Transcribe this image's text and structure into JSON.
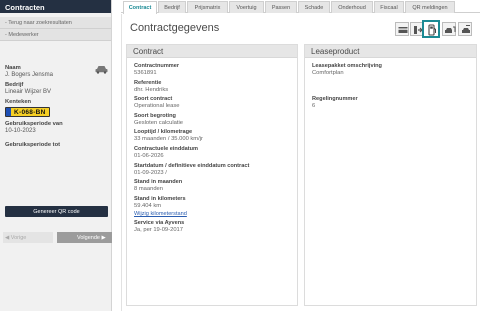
{
  "sidebar": {
    "title": "Contracten",
    "links": [
      "- Terug naar zoekresultaten",
      "- Medewerker"
    ],
    "name_label": "Naam",
    "name_value": "J. Bogers Jensma",
    "company_label": "Bedrijf",
    "company_value": "Lineair Wijzer BV",
    "plate_label": "Kenteken",
    "plate_value": "K-068-BN",
    "period_from_label": "Gebruiksperiode van",
    "period_from_value": "10-10-2023",
    "period_to_label": "Gebruiksperiode tot",
    "period_to_value": "",
    "qr_button": "Genereer QR code",
    "prev_button": "◀ Vorige",
    "next_button": "Volgende ▶"
  },
  "tabs": [
    {
      "label": "Contract",
      "active": true
    },
    {
      "label": "Bedrijf",
      "active": false
    },
    {
      "label": "Prijsmatrix",
      "active": false
    },
    {
      "label": "Voertuig",
      "active": false
    },
    {
      "label": "Passen",
      "active": false
    },
    {
      "label": "Schade",
      "active": false
    },
    {
      "label": "Onderhoud",
      "active": false
    },
    {
      "label": "Fiscaal",
      "active": false
    },
    {
      "label": "QR meldingen",
      "active": false
    }
  ],
  "page_title": "Contractgegevens",
  "toolbar_icons": [
    "card-icon",
    "document-arrow-icon",
    "fuel-pump-icon",
    "car-return-icon",
    "car-swap-icon"
  ],
  "contract": {
    "heading": "Contract",
    "fields": [
      {
        "label": "Contractnummer",
        "value": "5361891"
      },
      {
        "label": "Referentie",
        "value": "dhr. Hendriks"
      },
      {
        "label": "Soort contract",
        "value": "Operational lease"
      },
      {
        "label": "Soort begroting",
        "value": "Gesloten calculatie"
      },
      {
        "label": "Looptijd / kilometrage",
        "value": "33 maanden / 35.000 km/jr"
      },
      {
        "label": "Contractuele einddatum",
        "value": "01-06-2026"
      },
      {
        "label": "Startdatum / definitieve einddatum contract",
        "value": "01-09-2023 /"
      },
      {
        "label": "Stand in maanden",
        "value": "8 maanden"
      },
      {
        "label": "Stand in kilometers",
        "value": "59.404 km"
      },
      {
        "label": "Service via Ayvens",
        "value": "Ja, per 19-09-2017"
      }
    ],
    "km_link": "Wijzig kilometerstand"
  },
  "leaseproduct": {
    "heading": "Leaseproduct",
    "fields": [
      {
        "label": "Leasepakket omschrijving",
        "value": "Comfortplan"
      },
      {
        "label": "Regelingnummer",
        "value": "6"
      }
    ]
  },
  "colors": {
    "accent": "#1b8a94",
    "navy": "#243042",
    "plate_yellow": "#f6cf24"
  }
}
